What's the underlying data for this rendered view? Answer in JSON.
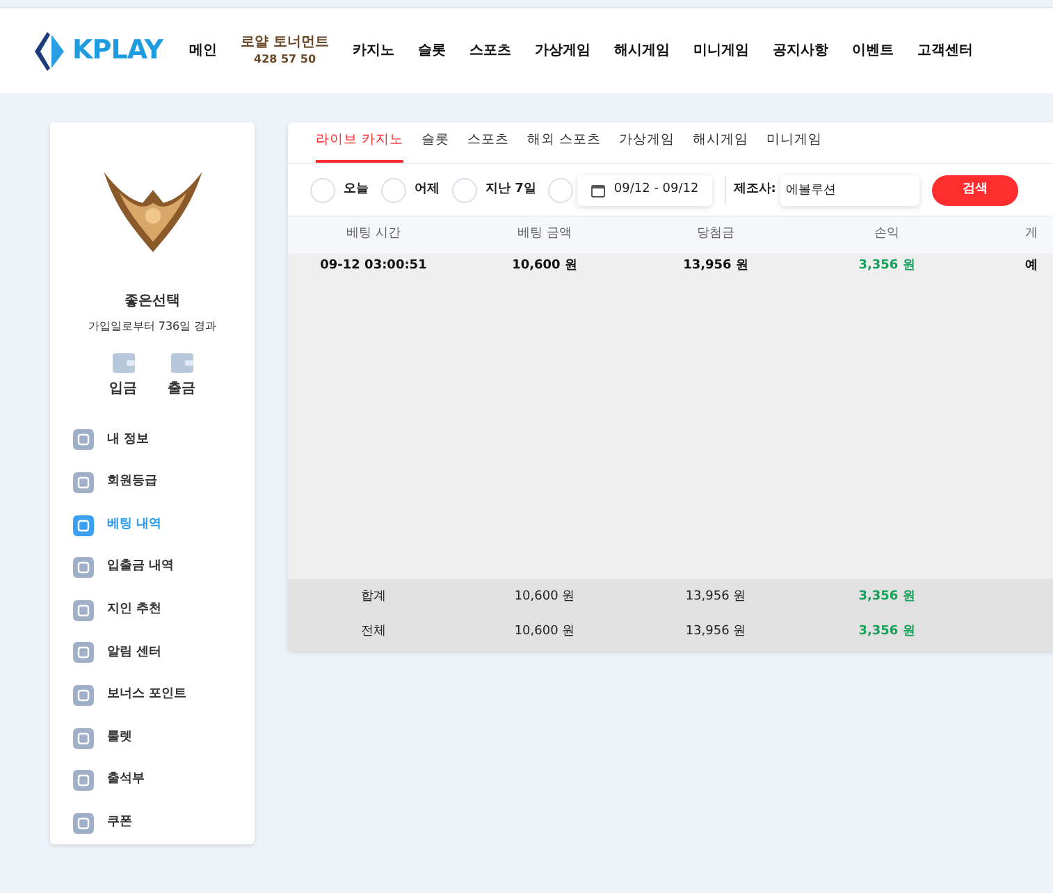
{
  "header": {
    "logo": "KPLAY",
    "nav": [
      {
        "label": "메인",
        "kind": "plain"
      },
      {
        "label": "로얄 토너먼트",
        "kind": "timer",
        "sub": "428 57 50"
      },
      {
        "label": "카지노",
        "kind": "plain"
      },
      {
        "label": "슬롯",
        "kind": "plain"
      },
      {
        "label": "스포츠",
        "kind": "plain"
      },
      {
        "label": "가상게임",
        "kind": "plain"
      },
      {
        "label": "해시게임",
        "kind": "plain"
      },
      {
        "label": "미니게임",
        "kind": "plain"
      },
      {
        "label": "공지사항",
        "kind": "plain"
      },
      {
        "label": "이벤트",
        "kind": "plain"
      },
      {
        "label": "고객센터",
        "kind": "plain"
      }
    ]
  },
  "profile": {
    "name": "좋은선택",
    "since": "가입일로부터 736일 경과",
    "actions": [
      "입금",
      "출금"
    ]
  },
  "menu": [
    {
      "label": "내 정보",
      "selected": false
    },
    {
      "label": "회원등급",
      "selected": false
    },
    {
      "label": "베팅 내역",
      "selected": true
    },
    {
      "label": "입출금 내역",
      "selected": false
    },
    {
      "label": "지인 추천",
      "selected": false
    },
    {
      "label": "알림 센터",
      "selected": false
    },
    {
      "label": "보너스 포인트",
      "selected": false
    },
    {
      "label": "룰렛",
      "selected": false
    },
    {
      "label": "출석부",
      "selected": false
    },
    {
      "label": "쿠폰",
      "selected": false
    }
  ],
  "tabs": [
    {
      "label": "라이브 카지노",
      "selected": true
    },
    {
      "label": "슬롯",
      "selected": false
    },
    {
      "label": "스포츠",
      "selected": false
    },
    {
      "label": "해외 스포츠",
      "selected": false
    },
    {
      "label": "가상게임",
      "selected": false
    },
    {
      "label": "해시게임",
      "selected": false
    },
    {
      "label": "미니게임",
      "selected": false
    }
  ],
  "filters": [
    {
      "label": "오늘",
      "checked": false
    },
    {
      "label": "어제",
      "checked": false
    },
    {
      "label": "지난 7일",
      "checked": false
    },
    {
      "checked": false
    }
  ],
  "date_range": "09/12 - 09/12",
  "maker": {
    "label": "제조사:",
    "value": "에볼루션"
  },
  "search_button": "검색",
  "table": {
    "columns": [
      "베팅 시간",
      "베팅 금액",
      "당첨금",
      "손익",
      "게"
    ],
    "rows": [
      {
        "cells": [
          "09-12 03:00:51",
          "10,600 원",
          "13,956 원",
          "3,356 원",
          "예"
        ]
      }
    ],
    "totals": [
      {
        "cells": [
          "합계",
          "10,600 원",
          "13,956 원",
          "3,356 원"
        ]
      },
      {
        "cells": [
          "전체",
          "10,600 원",
          "13,956 원",
          "3,356 원"
        ]
      }
    ]
  }
}
